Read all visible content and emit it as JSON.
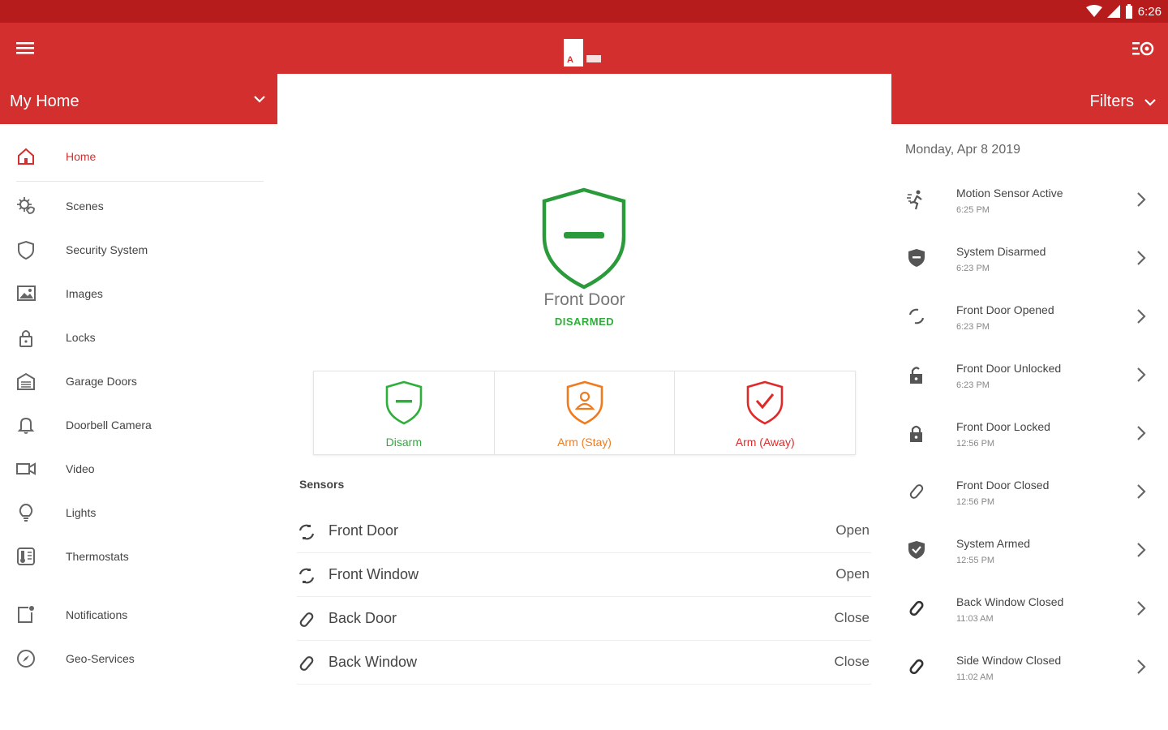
{
  "status_bar": {
    "time": "6:26"
  },
  "brand": {
    "accent": "#d32f2f",
    "status_bar_color": "#b71c1c",
    "green": "#2eae3a",
    "orange": "#f07b1e",
    "red": "#e02a2a"
  },
  "header": {
    "home_selector": "My Home",
    "filters_label": "Filters"
  },
  "sidebar": {
    "items": [
      {
        "label": "Home",
        "icon": "home-icon",
        "active": true
      },
      {
        "label": "Scenes",
        "icon": "scenes-icon"
      },
      {
        "label": "Security System",
        "icon": "shield-icon"
      },
      {
        "label": "Images",
        "icon": "image-icon"
      },
      {
        "label": "Locks",
        "icon": "lock-icon"
      },
      {
        "label": "Garage Doors",
        "icon": "garage-icon"
      },
      {
        "label": "Doorbell Camera",
        "icon": "bell-icon"
      },
      {
        "label": "Video",
        "icon": "video-icon"
      },
      {
        "label": "Lights",
        "icon": "bulb-icon"
      },
      {
        "label": "Thermostats",
        "icon": "thermostat-icon"
      },
      {
        "label": "Notifications",
        "icon": "notification-icon"
      },
      {
        "label": "Geo-Services",
        "icon": "compass-icon"
      }
    ]
  },
  "security": {
    "device_name": "Front Door",
    "state": "DISARMED",
    "actions": [
      {
        "label": "Disarm",
        "color": "#2eae3a"
      },
      {
        "label": "Arm (Stay)",
        "color": "#f07b1e"
      },
      {
        "label": "Arm (Away)",
        "color": "#e02a2a"
      }
    ]
  },
  "sensors": {
    "title": "Sensors",
    "rows": [
      {
        "name": "Front Door",
        "value": "Open",
        "icon": "sensor-open-icon"
      },
      {
        "name": "Front Window",
        "value": "Open",
        "icon": "sensor-open-icon"
      },
      {
        "name": "Back Door",
        "value": "Close",
        "icon": "sensor-closed-icon"
      },
      {
        "name": "Back Window",
        "value": "Close",
        "icon": "sensor-closed-icon"
      }
    ]
  },
  "activity": {
    "date": "Monday, Apr 8 2019",
    "events": [
      {
        "title": "Motion Sensor Active",
        "time": "6:25 PM",
        "icon": "motion-icon"
      },
      {
        "title": "System Disarmed",
        "time": "6:23 PM",
        "icon": "shield-minus-icon"
      },
      {
        "title": "Front Door Opened",
        "time": "6:23 PM",
        "icon": "sensor-open-icon"
      },
      {
        "title": "Front Door Unlocked",
        "time": "6:23 PM",
        "icon": "unlock-icon"
      },
      {
        "title": "Front Door Locked",
        "time": "12:56 PM",
        "icon": "lock-icon"
      },
      {
        "title": "Front Door Closed",
        "time": "12:56 PM",
        "icon": "sensor-closed-icon"
      },
      {
        "title": "System Armed",
        "time": "12:55 PM",
        "icon": "shield-check-icon"
      },
      {
        "title": "Back Window Closed",
        "time": "11:03 AM",
        "icon": "sensor-closed-icon"
      },
      {
        "title": "Side Window Closed",
        "time": "11:02 AM",
        "icon": "sensor-closed-icon"
      }
    ]
  }
}
